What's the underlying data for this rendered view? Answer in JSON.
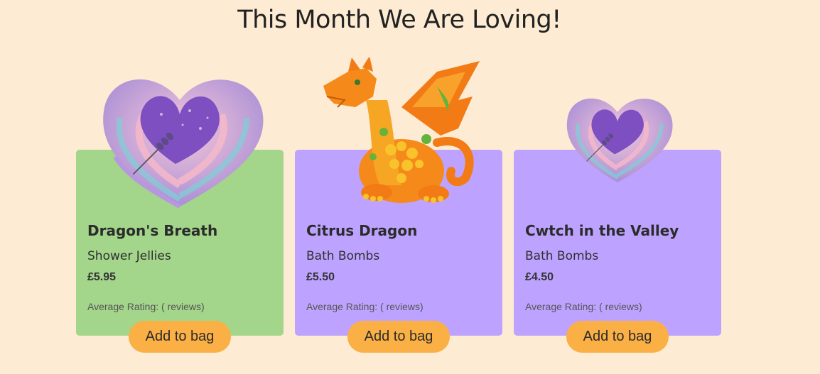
{
  "heading": "This Month We Are Loving!",
  "colors": {
    "background": "#fdebd3",
    "card_green": "#a3d58b",
    "card_purple": "#bda3ff",
    "button": "#fbb045"
  },
  "products": [
    {
      "name": "Dragon's Breath",
      "category": "Shower Jellies",
      "price": "£5.95",
      "rating": "Average Rating: ( reviews)",
      "button_label": "Add to bag",
      "image_icon": "heart-bath-bomb"
    },
    {
      "name": "Citrus Dragon",
      "category": "Bath Bombs",
      "price": "£5.50",
      "rating": "Average Rating: ( reviews)",
      "button_label": "Add to bag",
      "image_icon": "dragon-bath-bomb"
    },
    {
      "name": "Cwtch in the Valley",
      "category": "Bath Bombs",
      "price": "£4.50",
      "rating": "Average Rating: ( reviews)",
      "button_label": "Add to bag",
      "image_icon": "heart-bath-bomb"
    }
  ]
}
